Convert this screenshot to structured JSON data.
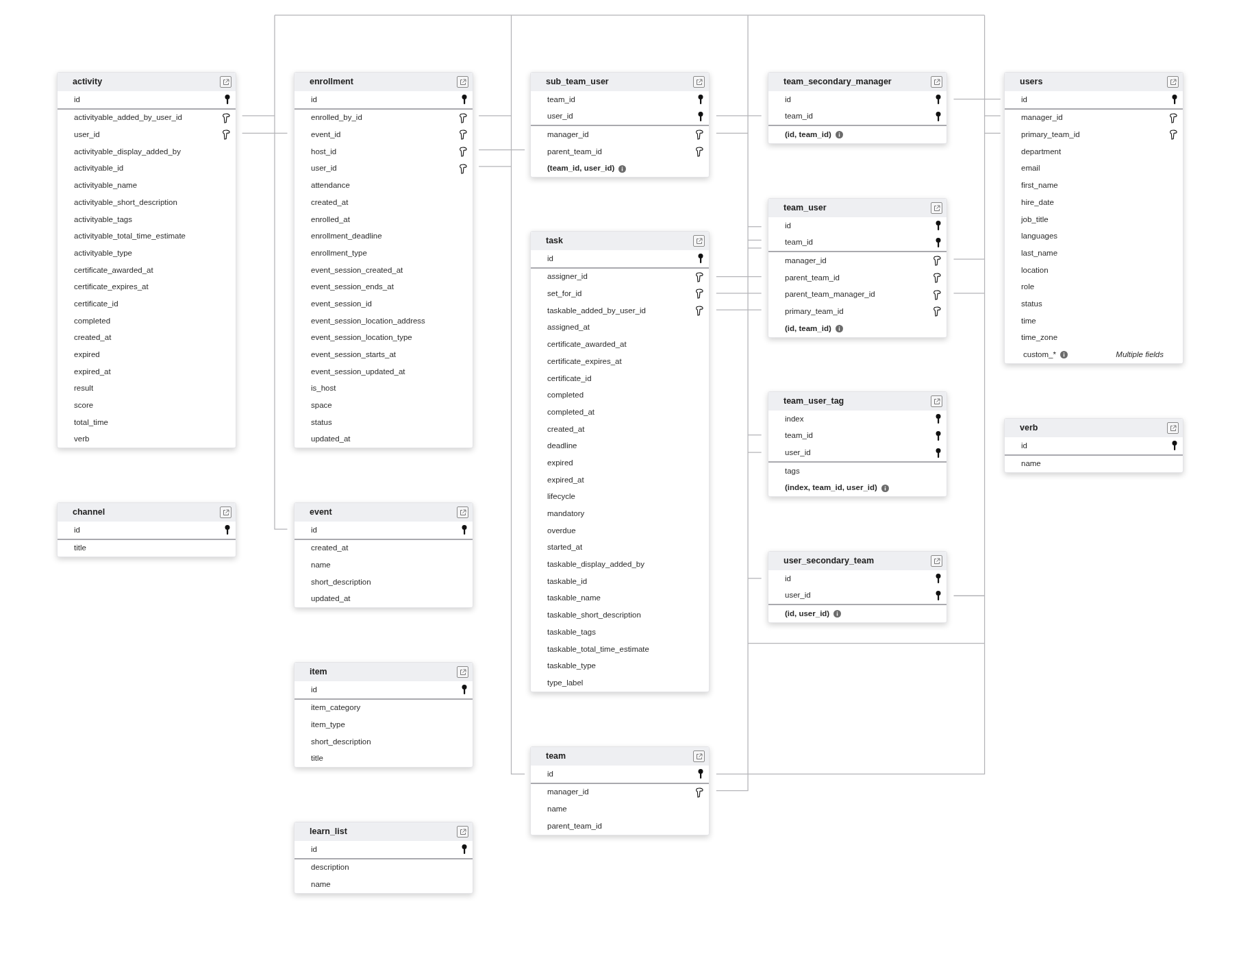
{
  "tables": [
    {
      "name": "activity",
      "fields": [
        {
          "name": "id",
          "kind": "primary"
        },
        {
          "name": "activityable_added_by_user_id",
          "kind": "foreign"
        },
        {
          "name": "user_id",
          "kind": "foreign"
        },
        {
          "name": "activityable_display_added_by",
          "kind": "plain"
        },
        {
          "name": "activityable_id",
          "kind": "plain"
        },
        {
          "name": "activityable_name",
          "kind": "plain"
        },
        {
          "name": "activityable_short_description",
          "kind": "plain"
        },
        {
          "name": "activityable_tags",
          "kind": "plain"
        },
        {
          "name": "activityable_total_time_estimate",
          "kind": "plain"
        },
        {
          "name": "activityable_type",
          "kind": "plain"
        },
        {
          "name": "certificate_awarded_at",
          "kind": "plain"
        },
        {
          "name": "certificate_expires_at",
          "kind": "plain"
        },
        {
          "name": "certificate_id",
          "kind": "plain"
        },
        {
          "name": "completed",
          "kind": "plain"
        },
        {
          "name": "created_at",
          "kind": "plain"
        },
        {
          "name": "expired",
          "kind": "plain"
        },
        {
          "name": "expired_at",
          "kind": "plain"
        },
        {
          "name": "result",
          "kind": "plain"
        },
        {
          "name": "score",
          "kind": "plain"
        },
        {
          "name": "total_time",
          "kind": "plain"
        },
        {
          "name": "verb",
          "kind": "plain"
        }
      ]
    },
    {
      "name": "channel",
      "fields": [
        {
          "name": "id",
          "kind": "primary"
        },
        {
          "name": "title",
          "kind": "plain"
        }
      ]
    },
    {
      "name": "enrollment",
      "fields": [
        {
          "name": "id",
          "kind": "primary"
        },
        {
          "name": "enrolled_by_id",
          "kind": "foreign"
        },
        {
          "name": "event_id",
          "kind": "foreign"
        },
        {
          "name": "host_id",
          "kind": "foreign"
        },
        {
          "name": "user_id",
          "kind": "foreign"
        },
        {
          "name": "attendance",
          "kind": "plain"
        },
        {
          "name": "created_at",
          "kind": "plain"
        },
        {
          "name": "enrolled_at",
          "kind": "plain"
        },
        {
          "name": "enrollment_deadline",
          "kind": "plain"
        },
        {
          "name": "enrollment_type",
          "kind": "plain"
        },
        {
          "name": "event_session_created_at",
          "kind": "plain"
        },
        {
          "name": "event_session_ends_at",
          "kind": "plain"
        },
        {
          "name": "event_session_id",
          "kind": "plain"
        },
        {
          "name": "event_session_location_address",
          "kind": "plain"
        },
        {
          "name": "event_session_location_type",
          "kind": "plain"
        },
        {
          "name": "event_session_starts_at",
          "kind": "plain"
        },
        {
          "name": "event_session_updated_at",
          "kind": "plain"
        },
        {
          "name": "is_host",
          "kind": "plain"
        },
        {
          "name": "space",
          "kind": "plain"
        },
        {
          "name": "status",
          "kind": "plain"
        },
        {
          "name": "updated_at",
          "kind": "plain"
        }
      ]
    },
    {
      "name": "event",
      "fields": [
        {
          "name": "id",
          "kind": "primary"
        },
        {
          "name": "created_at",
          "kind": "plain"
        },
        {
          "name": "name",
          "kind": "plain"
        },
        {
          "name": "short_description",
          "kind": "plain"
        },
        {
          "name": "updated_at",
          "kind": "plain"
        }
      ]
    },
    {
      "name": "item",
      "fields": [
        {
          "name": "id",
          "kind": "primary"
        },
        {
          "name": "item_category",
          "kind": "plain"
        },
        {
          "name": "item_type",
          "kind": "plain"
        },
        {
          "name": "short_description",
          "kind": "plain"
        },
        {
          "name": "title",
          "kind": "plain"
        }
      ]
    },
    {
      "name": "learn_list",
      "fields": [
        {
          "name": "id",
          "kind": "primary"
        },
        {
          "name": "description",
          "kind": "plain"
        },
        {
          "name": "name",
          "kind": "plain"
        }
      ]
    },
    {
      "name": "sub_team_user",
      "fields": [
        {
          "name": "team_id",
          "kind": "primary"
        },
        {
          "name": "user_id",
          "kind": "primary"
        },
        {
          "name": "manager_id",
          "kind": "foreign"
        },
        {
          "name": "parent_team_id",
          "kind": "foreign"
        },
        {
          "name": "(team_id, user_id)",
          "kind": "composite"
        }
      ]
    },
    {
      "name": "task",
      "fields": [
        {
          "name": "id",
          "kind": "primary"
        },
        {
          "name": "assigner_id",
          "kind": "foreign"
        },
        {
          "name": "set_for_id",
          "kind": "foreign"
        },
        {
          "name": "taskable_added_by_user_id",
          "kind": "foreign"
        },
        {
          "name": "assigned_at",
          "kind": "plain"
        },
        {
          "name": "certificate_awarded_at",
          "kind": "plain"
        },
        {
          "name": "certificate_expires_at",
          "kind": "plain"
        },
        {
          "name": "certificate_id",
          "kind": "plain"
        },
        {
          "name": "completed",
          "kind": "plain"
        },
        {
          "name": "completed_at",
          "kind": "plain"
        },
        {
          "name": "created_at",
          "kind": "plain"
        },
        {
          "name": "deadline",
          "kind": "plain"
        },
        {
          "name": "expired",
          "kind": "plain"
        },
        {
          "name": "expired_at",
          "kind": "plain"
        },
        {
          "name": "lifecycle",
          "kind": "plain"
        },
        {
          "name": "mandatory",
          "kind": "plain"
        },
        {
          "name": "overdue",
          "kind": "plain"
        },
        {
          "name": "started_at",
          "kind": "plain"
        },
        {
          "name": "taskable_display_added_by",
          "kind": "plain"
        },
        {
          "name": "taskable_id",
          "kind": "plain"
        },
        {
          "name": "taskable_name",
          "kind": "plain"
        },
        {
          "name": "taskable_short_description",
          "kind": "plain"
        },
        {
          "name": "taskable_tags",
          "kind": "plain"
        },
        {
          "name": "taskable_total_time_estimate",
          "kind": "plain"
        },
        {
          "name": "taskable_type",
          "kind": "plain"
        },
        {
          "name": "type_label",
          "kind": "plain"
        }
      ]
    },
    {
      "name": "team",
      "fields": [
        {
          "name": "id",
          "kind": "primary"
        },
        {
          "name": "manager_id",
          "kind": "foreign"
        },
        {
          "name": "name",
          "kind": "plain"
        },
        {
          "name": "parent_team_id",
          "kind": "plain"
        }
      ]
    },
    {
      "name": "team_secondary_manager",
      "fields": [
        {
          "name": "id",
          "kind": "primary"
        },
        {
          "name": "team_id",
          "kind": "primary"
        },
        {
          "name": "(id, team_id)",
          "kind": "composite"
        }
      ]
    },
    {
      "name": "team_user",
      "fields": [
        {
          "name": "id",
          "kind": "primary"
        },
        {
          "name": "team_id",
          "kind": "primary"
        },
        {
          "name": "manager_id",
          "kind": "foreign"
        },
        {
          "name": "parent_team_id",
          "kind": "foreign"
        },
        {
          "name": "parent_team_manager_id",
          "kind": "foreign"
        },
        {
          "name": "primary_team_id",
          "kind": "foreign"
        },
        {
          "name": "(id, team_id)",
          "kind": "composite"
        }
      ]
    },
    {
      "name": "team_user_tag",
      "fields": [
        {
          "name": "index",
          "kind": "primary"
        },
        {
          "name": "team_id",
          "kind": "primary"
        },
        {
          "name": "user_id",
          "kind": "primary"
        },
        {
          "name": "tags",
          "kind": "plain"
        },
        {
          "name": "(index, team_id, user_id)",
          "kind": "composite"
        }
      ]
    },
    {
      "name": "user_secondary_team",
      "fields": [
        {
          "name": "id",
          "kind": "primary"
        },
        {
          "name": "user_id",
          "kind": "primary"
        },
        {
          "name": "(id, user_id)",
          "kind": "composite"
        }
      ]
    },
    {
      "name": "users",
      "fields": [
        {
          "name": "id",
          "kind": "primary"
        },
        {
          "name": "manager_id",
          "kind": "foreign"
        },
        {
          "name": "primary_team_id",
          "kind": "foreign"
        },
        {
          "name": "department",
          "kind": "plain"
        },
        {
          "name": "email",
          "kind": "plain"
        },
        {
          "name": "first_name",
          "kind": "plain"
        },
        {
          "name": "hire_date",
          "kind": "plain"
        },
        {
          "name": "job_title",
          "kind": "plain"
        },
        {
          "name": "languages",
          "kind": "plain"
        },
        {
          "name": "last_name",
          "kind": "plain"
        },
        {
          "name": "location",
          "kind": "plain"
        },
        {
          "name": "role",
          "kind": "plain"
        },
        {
          "name": "status",
          "kind": "plain"
        },
        {
          "name": "time",
          "kind": "plain"
        },
        {
          "name": "time_zone",
          "kind": "plain"
        },
        {
          "name": "custom_*",
          "kind": "custom",
          "note": "Multiple fields"
        }
      ]
    },
    {
      "name": "verb",
      "fields": [
        {
          "name": "id",
          "kind": "primary"
        },
        {
          "name": "name",
          "kind": "plain"
        }
      ]
    }
  ]
}
